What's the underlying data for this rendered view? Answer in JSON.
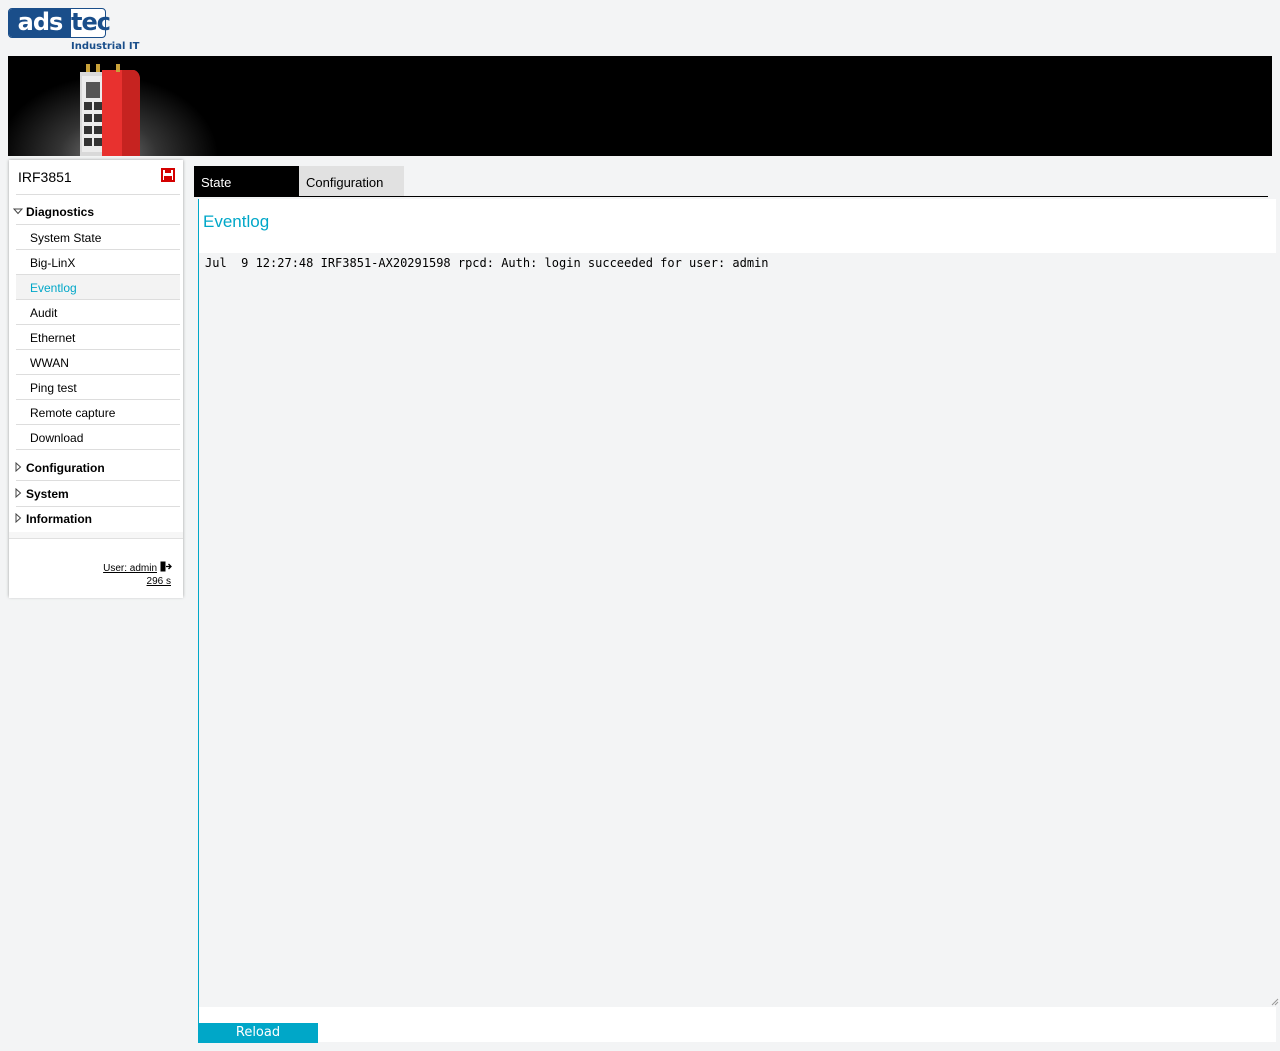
{
  "brand": {
    "logo_left": "ads",
    "logo_right": "tec",
    "tagline": "Industrial IT",
    "primary_color": "#1a4e8a",
    "accent_color": "#00a7c8"
  },
  "sidebar": {
    "device_name": "IRF3851",
    "save_icon": "save-icon",
    "groups": [
      {
        "label": "Diagnostics",
        "expanded": true,
        "items": [
          {
            "label": "System State"
          },
          {
            "label": "Big-LinX"
          },
          {
            "label": "Eventlog",
            "active": true
          },
          {
            "label": "Audit"
          },
          {
            "label": "Ethernet"
          },
          {
            "label": "WWAN"
          },
          {
            "label": "Ping test"
          },
          {
            "label": "Remote capture"
          },
          {
            "label": "Download"
          }
        ]
      },
      {
        "label": "Configuration",
        "expanded": false
      },
      {
        "label": "System",
        "expanded": false
      },
      {
        "label": "Information",
        "expanded": false
      }
    ],
    "user_label": "User: admin",
    "session_timer": "296 s"
  },
  "tabs": [
    {
      "label": "State",
      "active": true
    },
    {
      "label": "Configuration",
      "active": false
    }
  ],
  "panel": {
    "title": "Eventlog",
    "log_text": "Jul  9 12:27:48 IRF3851-AX20291598 rpcd: Auth: login succeeded for user: admin",
    "reload_label": "Reload"
  }
}
